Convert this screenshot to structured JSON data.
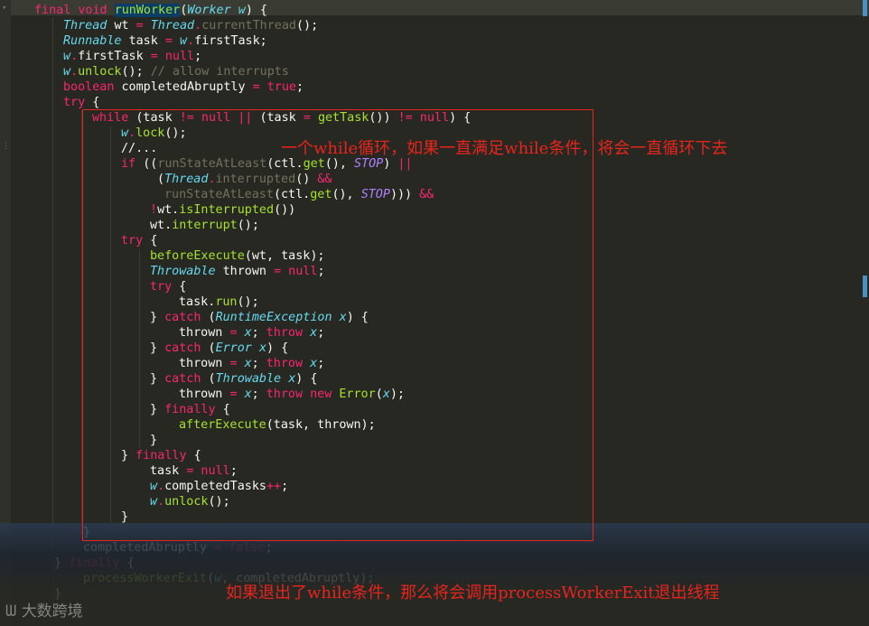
{
  "code_lines": [
    [
      {
        "t": "k",
        "s": "final "
      },
      {
        "t": "k",
        "s": "void "
      },
      {
        "t": "hl",
        "s": "runWorker"
      },
      {
        "t": "p",
        "s": "("
      },
      {
        "t": "t",
        "s": "Worker "
      },
      {
        "t": "v",
        "s": "w"
      },
      {
        "t": "p",
        "s": ") {"
      }
    ],
    [
      {
        "t": "t",
        "s": "Thread "
      },
      {
        "t": "p",
        "s": "wt "
      },
      {
        "t": "k",
        "s": "= "
      },
      {
        "t": "t",
        "s": "Thread"
      },
      {
        "t": "k",
        "s": "."
      },
      {
        "t": "c",
        "s": "currentThread"
      },
      {
        "t": "p",
        "s": "();"
      }
    ],
    [
      {
        "t": "t",
        "s": "Runnable "
      },
      {
        "t": "p",
        "s": "task "
      },
      {
        "t": "k",
        "s": "= "
      },
      {
        "t": "v",
        "s": "w"
      },
      {
        "t": "k",
        "s": "."
      },
      {
        "t": "p",
        "s": "firstTask;"
      }
    ],
    [
      {
        "t": "v",
        "s": "w"
      },
      {
        "t": "k",
        "s": "."
      },
      {
        "t": "p",
        "s": "firstTask "
      },
      {
        "t": "k",
        "s": "= null"
      },
      {
        "t": "p",
        "s": ";"
      }
    ],
    [
      {
        "t": "v",
        "s": "w"
      },
      {
        "t": "k",
        "s": "."
      },
      {
        "t": "f",
        "s": "unlock"
      },
      {
        "t": "p",
        "s": "(); "
      },
      {
        "t": "c",
        "s": "// allow interrupts"
      }
    ],
    [
      {
        "t": "k",
        "s": "boolean "
      },
      {
        "t": "p",
        "s": "completedAbruptly "
      },
      {
        "t": "k",
        "s": "= true"
      },
      {
        "t": "p",
        "s": ";"
      }
    ],
    [
      {
        "t": "k",
        "s": "try "
      },
      {
        "t": "p",
        "s": "{"
      }
    ],
    [
      {
        "t": "k",
        "s": "while "
      },
      {
        "t": "p",
        "s": "(task "
      },
      {
        "t": "k",
        "s": "!= null || "
      },
      {
        "t": "p",
        "s": "(task "
      },
      {
        "t": "k",
        "s": "= "
      },
      {
        "t": "f",
        "s": "getTask"
      },
      {
        "t": "p",
        "s": "()) "
      },
      {
        "t": "k",
        "s": "!= null"
      },
      {
        "t": "p",
        "s": ") {"
      }
    ],
    [
      {
        "t": "v",
        "s": "w"
      },
      {
        "t": "k",
        "s": "."
      },
      {
        "t": "f",
        "s": "lock"
      },
      {
        "t": "p",
        "s": "();"
      }
    ],
    [
      {
        "t": "p",
        "s": "//..."
      }
    ],
    [
      {
        "t": "k",
        "s": "if "
      },
      {
        "t": "p",
        "s": "(("
      },
      {
        "t": "c",
        "s": "runStateAtLeast"
      },
      {
        "t": "p",
        "s": "(ctl."
      },
      {
        "t": "f",
        "s": "get"
      },
      {
        "t": "p",
        "s": "(), "
      },
      {
        "t": "st",
        "s": "STOP"
      },
      {
        "t": "p",
        "s": ") "
      },
      {
        "t": "k",
        "s": "||"
      }
    ],
    [
      {
        "t": "p",
        "s": "("
      },
      {
        "t": "t",
        "s": "Thread"
      },
      {
        "t": "k",
        "s": "."
      },
      {
        "t": "c",
        "s": "interrupted"
      },
      {
        "t": "p",
        "s": "() "
      },
      {
        "t": "k",
        "s": "&&"
      }
    ],
    [
      {
        "t": "c",
        "s": "runStateAtLeast"
      },
      {
        "t": "p",
        "s": "(ctl."
      },
      {
        "t": "f",
        "s": "get"
      },
      {
        "t": "p",
        "s": "(), "
      },
      {
        "t": "st",
        "s": "STOP"
      },
      {
        "t": "p",
        "s": "))) "
      },
      {
        "t": "k",
        "s": "&&"
      }
    ],
    [
      {
        "t": "k",
        "s": "!"
      },
      {
        "t": "p",
        "s": "wt."
      },
      {
        "t": "f",
        "s": "isInterrupted"
      },
      {
        "t": "p",
        "s": "())"
      }
    ],
    [
      {
        "t": "p",
        "s": "wt."
      },
      {
        "t": "f",
        "s": "interrupt"
      },
      {
        "t": "p",
        "s": "();"
      }
    ],
    [
      {
        "t": "k",
        "s": "try "
      },
      {
        "t": "p",
        "s": "{"
      }
    ],
    [
      {
        "t": "f",
        "s": "beforeExecute"
      },
      {
        "t": "p",
        "s": "(wt, task);"
      }
    ],
    [
      {
        "t": "t",
        "s": "Throwable "
      },
      {
        "t": "p",
        "s": "thrown "
      },
      {
        "t": "k",
        "s": "= null"
      },
      {
        "t": "p",
        "s": ";"
      }
    ],
    [
      {
        "t": "k",
        "s": "try "
      },
      {
        "t": "p",
        "s": "{"
      }
    ],
    [
      {
        "t": "p",
        "s": "task."
      },
      {
        "t": "f",
        "s": "run"
      },
      {
        "t": "p",
        "s": "();"
      }
    ],
    [
      {
        "t": "p",
        "s": "} "
      },
      {
        "t": "k",
        "s": "catch "
      },
      {
        "t": "p",
        "s": "("
      },
      {
        "t": "t",
        "s": "RuntimeException "
      },
      {
        "t": "v",
        "s": "x"
      },
      {
        "t": "p",
        "s": ") {"
      }
    ],
    [
      {
        "t": "p",
        "s": "thrown "
      },
      {
        "t": "k",
        "s": "= "
      },
      {
        "t": "v",
        "s": "x"
      },
      {
        "t": "p",
        "s": "; "
      },
      {
        "t": "k",
        "s": "throw "
      },
      {
        "t": "v",
        "s": "x"
      },
      {
        "t": "p",
        "s": ";"
      }
    ],
    [
      {
        "t": "p",
        "s": "} "
      },
      {
        "t": "k",
        "s": "catch "
      },
      {
        "t": "p",
        "s": "("
      },
      {
        "t": "t",
        "s": "Error "
      },
      {
        "t": "v",
        "s": "x"
      },
      {
        "t": "p",
        "s": ") {"
      }
    ],
    [
      {
        "t": "p",
        "s": "thrown "
      },
      {
        "t": "k",
        "s": "= "
      },
      {
        "t": "v",
        "s": "x"
      },
      {
        "t": "p",
        "s": "; "
      },
      {
        "t": "k",
        "s": "throw "
      },
      {
        "t": "v",
        "s": "x"
      },
      {
        "t": "p",
        "s": ";"
      }
    ],
    [
      {
        "t": "p",
        "s": "} "
      },
      {
        "t": "k",
        "s": "catch "
      },
      {
        "t": "p",
        "s": "("
      },
      {
        "t": "t",
        "s": "Throwable "
      },
      {
        "t": "v",
        "s": "x"
      },
      {
        "t": "p",
        "s": ") {"
      }
    ],
    [
      {
        "t": "p",
        "s": "thrown "
      },
      {
        "t": "k",
        "s": "= "
      },
      {
        "t": "v",
        "s": "x"
      },
      {
        "t": "p",
        "s": "; "
      },
      {
        "t": "k",
        "s": "throw new "
      },
      {
        "t": "f",
        "s": "Error"
      },
      {
        "t": "p",
        "s": "("
      },
      {
        "t": "v",
        "s": "x"
      },
      {
        "t": "p",
        "s": ");"
      }
    ],
    [
      {
        "t": "p",
        "s": "} "
      },
      {
        "t": "k",
        "s": "finally "
      },
      {
        "t": "p",
        "s": "{"
      }
    ],
    [
      {
        "t": "f",
        "s": "afterExecute"
      },
      {
        "t": "p",
        "s": "(task, thrown);"
      }
    ],
    [
      {
        "t": "p",
        "s": "}"
      }
    ],
    [
      {
        "t": "p",
        "s": "} "
      },
      {
        "t": "k",
        "s": "finally "
      },
      {
        "t": "p",
        "s": "{"
      }
    ],
    [
      {
        "t": "p",
        "s": "task "
      },
      {
        "t": "k",
        "s": "= null"
      },
      {
        "t": "p",
        "s": ";"
      }
    ],
    [
      {
        "t": "v",
        "s": "w"
      },
      {
        "t": "k",
        "s": "."
      },
      {
        "t": "p",
        "s": "completedTasks"
      },
      {
        "t": "k",
        "s": "++"
      },
      {
        "t": "p",
        "s": ";"
      }
    ],
    [
      {
        "t": "v",
        "s": "w"
      },
      {
        "t": "k",
        "s": "."
      },
      {
        "t": "f",
        "s": "unlock"
      },
      {
        "t": "p",
        "s": "();"
      }
    ],
    [
      {
        "t": "p",
        "s": "}"
      }
    ],
    [
      {
        "t": "p",
        "s": "}"
      }
    ],
    [
      {
        "t": "p",
        "s": "completedAbruptly "
      },
      {
        "t": "k",
        "s": "= false"
      },
      {
        "t": "p",
        "s": ";"
      }
    ],
    [
      {
        "t": "p",
        "s": "} "
      },
      {
        "t": "k",
        "s": "finally "
      },
      {
        "t": "p",
        "s": "{"
      }
    ],
    [
      {
        "t": "f",
        "s": "processWorkerExit"
      },
      {
        "t": "p",
        "s": "("
      },
      {
        "t": "v",
        "s": "w"
      },
      {
        "t": "p",
        "s": ", completedAbruptly);"
      }
    ],
    [
      {
        "t": "p",
        "s": "}"
      }
    ]
  ],
  "annotations": {
    "while_loop": "一个while循环，如果一直满足while条件，将会一直循环下去",
    "exit": "如果退出了while条件，那么将会调用processWorkerExit退出线程"
  },
  "watermark": "大数跨境",
  "colors": {
    "background": "#272822",
    "keyword": "#f92672",
    "type": "#66d9ef",
    "function": "#a6e22e",
    "comment": "#75715e",
    "constant": "#ae81ff",
    "annotation_red": "#e8241d"
  }
}
